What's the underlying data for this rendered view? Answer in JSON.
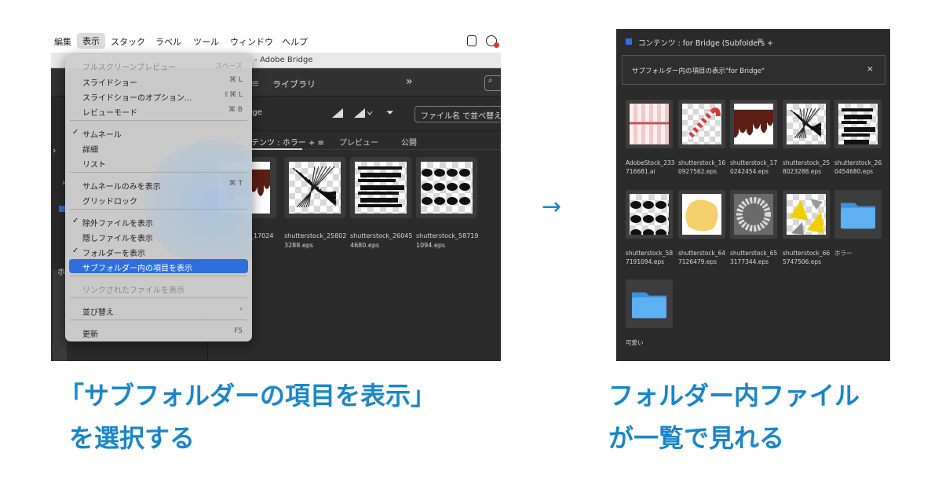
{
  "left_screenshot": {
    "menubar": [
      "編集",
      "表示",
      "スタック",
      "ラベル",
      "ツール",
      "ウィンドウ",
      "ヘルプ"
    ],
    "window_title": "e - Adobe Bridge",
    "toolbar": {
      "library_tab": "ライブラリ",
      "chevrons": "»",
      "search_glyph": "⌕",
      "hamburger": "≡"
    },
    "path_crumb": "dge",
    "sort_label": "ファイル名 で並べ替え",
    "filter_glyph": "⏷",
    "content_tabs": {
      "contents": "ンテンツ : ホラー +  ≡",
      "preview": "プレビュー",
      "publish": "公開"
    },
    "left_panel": {
      "glyph1": "›",
      "glyph2": "›",
      "side_label": "ホ"
    },
    "view_menu": [
      {
        "label": "フルスクリーンプレビュー",
        "shortcut": "スペース",
        "check": "",
        "disabled": true
      },
      {
        "label": "スライドショー",
        "shortcut": "⌘ L",
        "check": ""
      },
      {
        "label": "スライドショーのオプション...",
        "shortcut": "⇧⌘ L",
        "check": ""
      },
      {
        "label": "レビューモード",
        "shortcut": "⌘ B",
        "check": ""
      },
      {
        "label": "サムネール",
        "shortcut": "",
        "check": "✓"
      },
      {
        "label": "詳細",
        "shortcut": "",
        "check": ""
      },
      {
        "label": "リスト",
        "shortcut": "",
        "check": ""
      },
      {
        "label": "サムネールのみを表示",
        "shortcut": "⌘ T",
        "check": ""
      },
      {
        "label": "グリッドロック",
        "shortcut": "",
        "check": ""
      },
      {
        "label": "除外ファイルを表示",
        "shortcut": "",
        "check": "✓"
      },
      {
        "label": "隠しファイルを表示",
        "shortcut": "",
        "check": ""
      },
      {
        "label": "フォルダーを表示",
        "shortcut": "",
        "check": "✓"
      },
      {
        "label": "サブフォルダー内の項目を表示",
        "shortcut": "",
        "check": "",
        "highlighted": true
      },
      {
        "label": "リンクされたファイルを表示",
        "shortcut": "",
        "check": "",
        "disabled": true
      },
      {
        "label": "並び替え",
        "shortcut": "›",
        "check": ""
      },
      {
        "label": "更新",
        "shortcut": "F5",
        "check": ""
      }
    ],
    "thumbnails": [
      {
        "caption": "_17024",
        "art": "drip"
      },
      {
        "caption": "shutterstock_258023288.eps",
        "art": "scratch"
      },
      {
        "caption": "shutterstock_260454680.eps",
        "art": "bars"
      },
      {
        "caption": "shutterstock_587191094.eps",
        "art": "blobs"
      }
    ]
  },
  "arrow": "→",
  "right_screenshot": {
    "panel_title": "コンテンツ : for Bridge (Subfolders +",
    "panel_menu": "≡",
    "notice": "サブフォルダー内の項目の表示\"for Bridge\"",
    "close": "×",
    "items": [
      {
        "caption": "AdobeStock_233716681.ai",
        "art": "pink"
      },
      {
        "caption": "shutterstock_160927562.eps",
        "art": "candy"
      },
      {
        "caption": "shutterstock_170242454.eps",
        "art": "drip"
      },
      {
        "caption": "shutterstock_258023288.eps",
        "art": "scratch"
      },
      {
        "caption": "shutterstock_260454680.eps",
        "art": "bars"
      },
      {
        "caption": "shutterstock_587191094.eps",
        "art": "blobs"
      },
      {
        "caption": "shutterstock_647126479.eps",
        "art": "yellow"
      },
      {
        "caption": "shutterstock_653177344.eps",
        "art": "wreath"
      },
      {
        "caption": "shutterstock_665747506.eps",
        "art": "geo"
      },
      {
        "caption": "ホラー",
        "art": "folder"
      },
      {
        "caption": "可愛い",
        "art": "folder"
      }
    ]
  },
  "captions": {
    "left_line1": "「サブフォルダーの項目を表示」",
    "left_line2": "を選択する",
    "right_line1": "フォルダー内ファイル",
    "right_line2": "が一覧で見れる"
  },
  "colors": {
    "accent_blue": "#1a86c8",
    "menu_highlight": "#2f6fdc",
    "folder_blue": "#4fa3e8"
  }
}
